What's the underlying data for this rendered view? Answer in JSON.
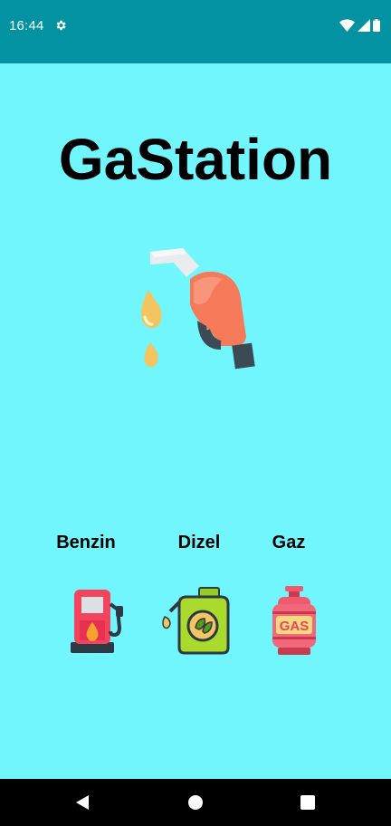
{
  "status_bar": {
    "time": "16:44",
    "icons": [
      "settings-gear-icon",
      "wifi-icon",
      "signal-icon",
      "battery-icon"
    ]
  },
  "app": {
    "title": "GaStation",
    "hero_icon": "fuel-nozzle-icon"
  },
  "fuel_options": [
    {
      "label": "Benzin",
      "icon": "gas-pump-icon"
    },
    {
      "label": "Dizel",
      "icon": "eco-fuel-canister-icon"
    },
    {
      "label": "Gaz",
      "icon": "gas-cylinder-icon",
      "icon_text": "GAS"
    }
  ],
  "navigation": {
    "buttons": [
      "back-icon",
      "home-icon",
      "recents-icon"
    ]
  },
  "colors": {
    "background": "#72f6fe",
    "status_bar": "#0292a2",
    "nav_bar": "#000000"
  }
}
